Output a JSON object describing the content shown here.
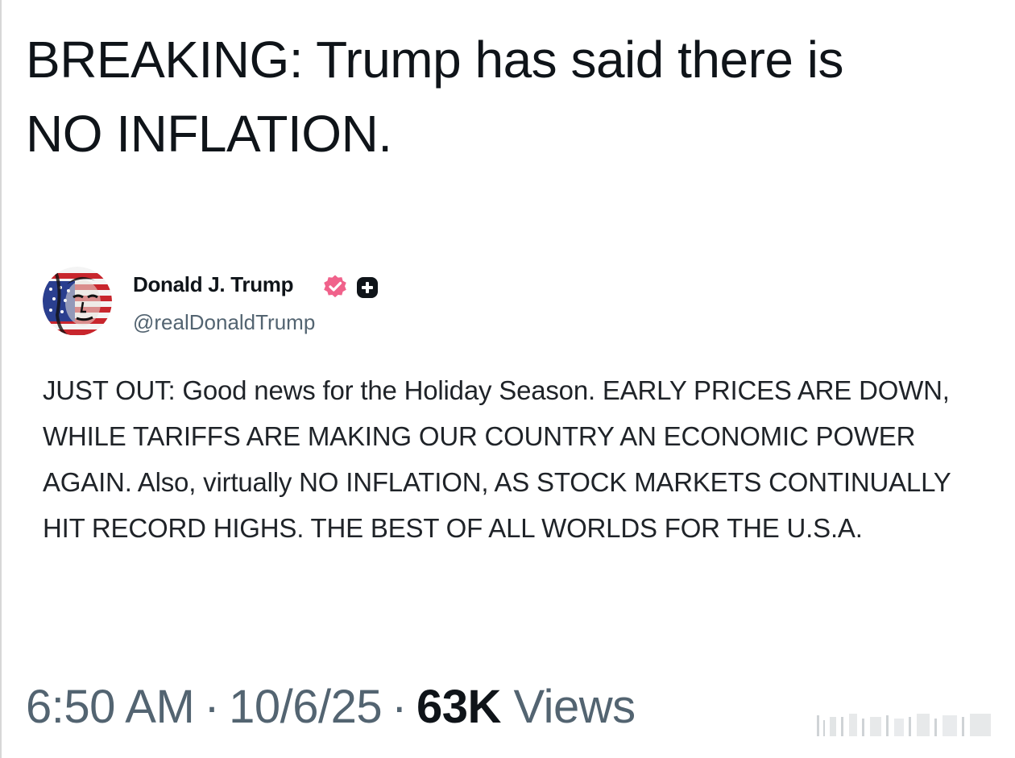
{
  "headline": {
    "line1": "BREAKING: Trump has said there is",
    "line2": "NO INFLATION."
  },
  "post": {
    "author_name": "Donald J. Trump",
    "author_handle": "@realDonaldTrump",
    "body": "JUST OUT: Good news for the Holiday Season. EARLY PRICES ARE DOWN, WHILE TARIFFS ARE MAKING OUR COUNTRY AN ECONOMIC POWER AGAIN. Also, virtually NO INFLATION, AS STOCK MARKETS CONTINUALLY HIT RECORD HIGHS. THE BEST OF ALL WORLDS FOR THE U.S.A."
  },
  "meta": {
    "time": "6:50 AM",
    "separator": "·",
    "date": "10/6/25",
    "views_count": "63K",
    "views_label": "Views"
  },
  "icons": {
    "avatar": "avatar",
    "verified": "verified-badge-icon",
    "follow": "follow-plus-icon",
    "watermark": "watermark-icon"
  },
  "colors": {
    "text_primary": "#0f1419",
    "text_secondary": "#536471",
    "verified_badge": "#f0628b"
  }
}
